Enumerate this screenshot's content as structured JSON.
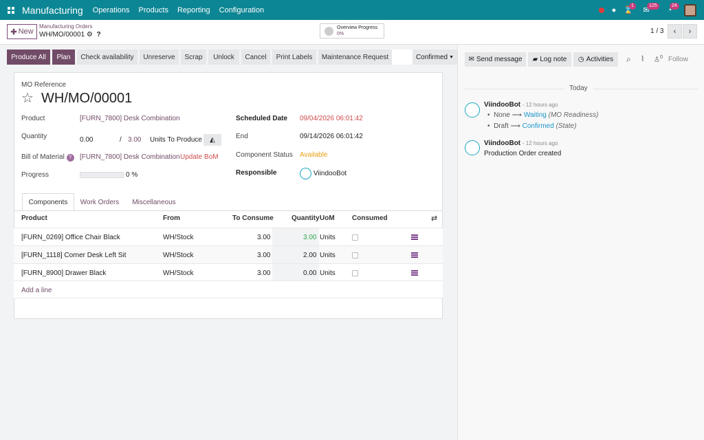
{
  "nav": {
    "brand": "Manufacturing",
    "menus": [
      "Operations",
      "Products",
      "Reporting",
      "Configuration"
    ],
    "badges": {
      "activity": "1",
      "messages": "125",
      "clock": "24"
    }
  },
  "control": {
    "new_label": "New",
    "breadcrumb_parent": "Manufacturing Orders",
    "breadcrumb_current": "WH/MO/00001",
    "overview_title": "Overview Progress",
    "overview_value": "0%",
    "pager": "1 / 3"
  },
  "actions": {
    "buttons": [
      "Produce All",
      "Plan",
      "Check availability",
      "Unreserve",
      "Scrap",
      "Unlock",
      "Cancel",
      "Print Labels",
      "Maintenance Request"
    ],
    "status": "Confirmed"
  },
  "form": {
    "mo_reference_label": "MO Reference",
    "mo_reference": "WH/MO/00001",
    "product_label": "Product",
    "product": "[FURN_7800] Desk Combination",
    "quantity_label": "Quantity",
    "qty_produced": "0.00",
    "qty_sep": "/",
    "qty_total": "3.00",
    "qty_unit": "Units To Produce",
    "bom_label": "Bill of Material",
    "bom": "[FURN_7800] Desk Combination",
    "update_bom": "Update BoM",
    "progress_label": "Progress",
    "progress_value": "0 %",
    "progress_fraction": 0,
    "scheduled_label": "Scheduled Date",
    "scheduled": "09/04/2026 06:01:42",
    "end_label": "End",
    "end": "09/14/2026 06:01:42",
    "component_status_label": "Component Status",
    "component_status": "Available",
    "responsible_label": "Responsible",
    "responsible": "ViindooBot"
  },
  "tabs": [
    "Components",
    "Work Orders",
    "Miscellaneous"
  ],
  "table": {
    "headers": [
      "Product",
      "From",
      "To Consume",
      "Quantity",
      "UoM",
      "Consumed"
    ],
    "rows": [
      {
        "product": "[FURN_0269] Office Chair Black",
        "from": "WH/Stock",
        "to_consume": "3.00",
        "quantity": "3.00",
        "uom": "Units"
      },
      {
        "product": "[FURN_1118] Corner Desk Left Sit",
        "from": "WH/Stock",
        "to_consume": "3.00",
        "quantity": "2.00",
        "uom": "Units"
      },
      {
        "product": "[FURN_8900] Drawer Black",
        "from": "WH/Stock",
        "to_consume": "3.00",
        "quantity": "0.00",
        "uom": "Units"
      }
    ],
    "add_line": "Add a line"
  },
  "chatter": {
    "send_message": "Send message",
    "log_note": "Log note",
    "activities": "Activities",
    "followers_count": "0",
    "follow": "Follow",
    "today": "Today",
    "msg1": {
      "author": "ViindooBot",
      "time": "- 12 hours ago",
      "c1_from": "None",
      "c1_arrow": "⟶",
      "c1_to": "Waiting",
      "c1_field": "(MO Readiness)",
      "c2_from": "Draft",
      "c2_arrow": "⟶",
      "c2_to": "Confirmed",
      "c2_field": "(State)"
    },
    "msg2": {
      "author": "ViindooBot",
      "time": "- 12 hours ago",
      "body": "Production Order created"
    }
  }
}
